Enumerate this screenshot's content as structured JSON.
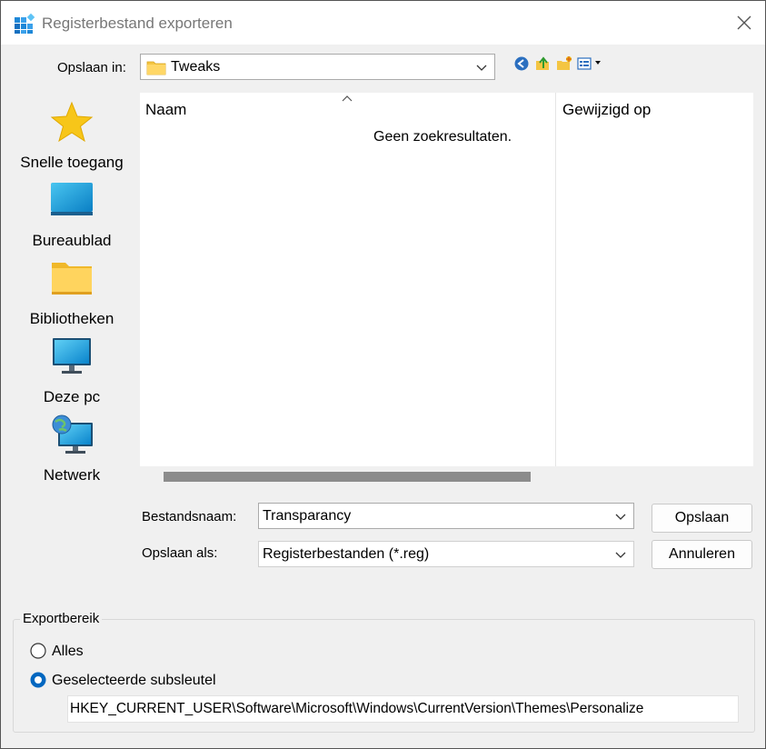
{
  "window": {
    "title": "Registerbestand exporteren"
  },
  "save_in": {
    "label": "Opslaan in:",
    "value": "Tweaks"
  },
  "places": [
    {
      "label": "Snelle toegang",
      "icon": "star-icon"
    },
    {
      "label": "Bureaublad",
      "icon": "desktop-icon"
    },
    {
      "label": "Bibliotheken",
      "icon": "folder-icon"
    },
    {
      "label": "Deze pc",
      "icon": "monitor-icon"
    },
    {
      "label": "Netwerk",
      "icon": "network-icon"
    }
  ],
  "filelist": {
    "col_name": "Naam",
    "col_modified": "Gewijzigd op",
    "empty_message": "Geen zoekresultaten."
  },
  "filename": {
    "label": "Bestandsnaam:",
    "value": "Transparancy"
  },
  "save_as": {
    "label": "Opslaan als:",
    "value": "Registerbestanden (*.reg)"
  },
  "buttons": {
    "save": "Opslaan",
    "cancel": "Annuleren"
  },
  "export_range": {
    "label": "Exportbereik",
    "option_all": "Alles",
    "option_selected": "Geselecteerde subsleutel",
    "selected": "selected",
    "key_path": "HKEY_CURRENT_USER\\Software\\Microsoft\\Windows\\CurrentVersion\\Themes\\Personalize"
  },
  "colors": {
    "accent": "#0067c0",
    "scrollbar": "#8c8c8c"
  }
}
